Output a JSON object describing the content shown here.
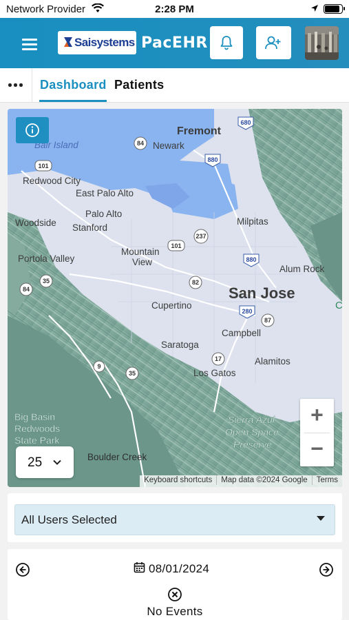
{
  "status_bar": {
    "carrier": "Network Provider",
    "time": "2:28 PM",
    "battery_level": 0.9
  },
  "app_bar": {
    "logo_text": "Saisystems",
    "app_name": "PacEHR",
    "icons": [
      "menu-icon",
      "bell-icon",
      "add-user-icon"
    ]
  },
  "tabs": {
    "items": [
      {
        "label": "Dashboard",
        "active": true
      },
      {
        "label": "Patients",
        "active": false
      }
    ]
  },
  "map": {
    "zoom_in_label": "+",
    "zoom_out_label": "−",
    "radius_value": "25",
    "attribution": {
      "shortcuts": "Keyboard shortcuts",
      "data": "Map data ©2024 Google",
      "terms": "Terms"
    },
    "places": {
      "fremont": "Fremont",
      "newark": "Newark",
      "bair_island": "Bair Island",
      "redwood_city": "Redwood City",
      "east_palo_alto": "East Palo Alto",
      "palo_alto": "Palo Alto",
      "stanford": "Stanford",
      "woodside": "Woodside",
      "milpitas": "Milpitas",
      "portola_valley": "Portola Valley",
      "mountain_view_1": "Mountain",
      "mountain_view_2": "View",
      "alum_rock": "Alum Rock",
      "san_jose": "San Jose",
      "cupertino": "Cupertino",
      "campbell": "Campbell",
      "saratoga": "Saratoga",
      "alamitos": "Alamitos",
      "los_gatos": "Los Gatos",
      "big_basin_1": "Big Basin",
      "big_basin_2": "Redwoods",
      "big_basin_3": "State Park",
      "sierra_azul_1": "Sierra Azul",
      "sierra_azul_2": "Open Space",
      "sierra_azul_3": "Preserve",
      "boulder_creek": "Boulder Creek",
      "partial_c": "C"
    },
    "shields": {
      "i680": "680",
      "r84a": "84",
      "i880a": "880",
      "r101a": "101",
      "r237": "237",
      "r101b": "101",
      "i880b": "880",
      "r82": "82",
      "r35a": "35",
      "r84b": "84",
      "i280": "280",
      "r87": "87",
      "r17": "17",
      "r9": "9",
      "r35b": "35"
    },
    "colors": {
      "water": "#8ab4f0",
      "land": "#dde2ee",
      "terrain": "#7fa69a"
    }
  },
  "user_filter": {
    "selected": "All Users Selected"
  },
  "events": {
    "date": "08/01/2024",
    "empty_text": "No Events"
  }
}
